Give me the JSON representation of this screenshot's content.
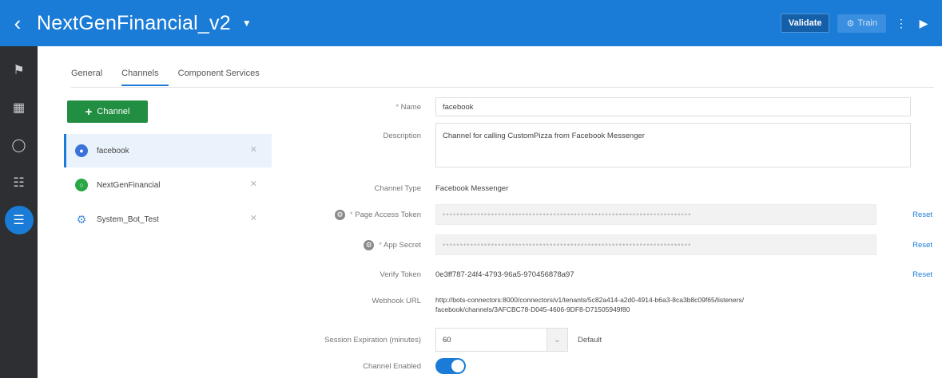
{
  "header": {
    "title": "NextGenFinancial_v2",
    "validate_label": "Validate",
    "train_label": "Train"
  },
  "tabs": [
    "General",
    "Channels",
    "Component Services"
  ],
  "add_channel_label": "Channel",
  "channels": [
    {
      "name": "facebook",
      "icon": "facebook-icon",
      "color": "#3b73d9"
    },
    {
      "name": "NextGenFinancial",
      "icon": "web-channel-icon",
      "color": "#28a745"
    },
    {
      "name": "System_Bot_Test",
      "icon": "gear-icon",
      "color": "#4a90d9"
    }
  ],
  "form": {
    "name_label": "Name",
    "name_value": "facebook",
    "description_label": "Description",
    "description_value": "Channel for calling CustomPizza from Facebook Messenger",
    "channel_type_label": "Channel Type",
    "channel_type_value": "Facebook Messenger",
    "page_access_token_label": "Page Access Token",
    "page_access_token_value": "••••••••••••••••••••••••••••••••••••••••••••••••••••••••••••••••••••••••",
    "app_secret_label": "App Secret",
    "app_secret_value": "••••••••••••••••••••••••••••••••••••••••••••••••••••••••••••••••••••••••",
    "verify_token_label": "Verify Token",
    "verify_token_value": "0e3ff787-24f4-4793-96a5-970456878a97",
    "webhook_url_label": "Webhook URL",
    "webhook_url_line1": "http://bots-connectors:8000/connectors/v1/tenants/5c82a414-a2d0-4914-b6a3-8ca3b8c09f65/listeners/",
    "webhook_url_line2": "facebook/channels/3AFCBC78-D045-4606-9DF8-D71505949f80",
    "reset_label": "Reset",
    "session_expiration_label": "Session Expiration (minutes)",
    "session_expiration_value": "60",
    "default_label": "Default",
    "channel_enabled_label": "Channel Enabled",
    "channel_enabled": true
  },
  "colors": {
    "header_blue": "#1a7cd6",
    "add_green": "#218e41",
    "nav_dark": "#2d2f33"
  }
}
